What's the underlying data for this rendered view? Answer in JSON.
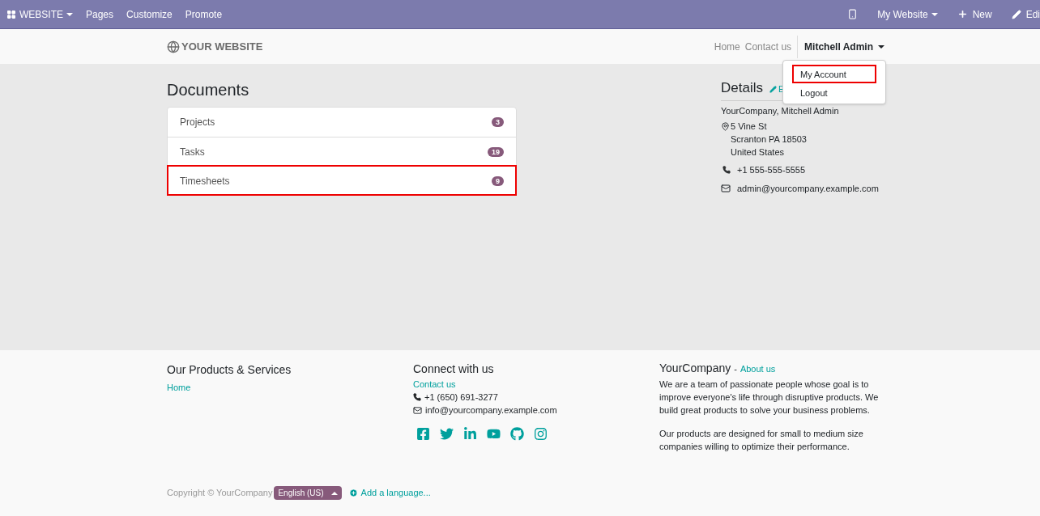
{
  "topbar": {
    "app_menu": "WEBSITE",
    "menu": [
      "Pages",
      "Customize",
      "Promote"
    ],
    "website_switcher": "My Website",
    "new_button": "New",
    "edit_button": "Edi"
  },
  "header": {
    "logo": "YOUR WEBSITE",
    "nav": [
      "Home",
      "Contact us"
    ],
    "user": "Mitchell Admin"
  },
  "user_menu": {
    "items": [
      {
        "label": "My Account",
        "highlighted": true
      },
      {
        "label": "Logout",
        "highlighted": false
      }
    ]
  },
  "documents": {
    "title": "Documents",
    "items": [
      {
        "label": "Projects",
        "count": "3",
        "highlighted": false
      },
      {
        "label": "Tasks",
        "count": "19",
        "highlighted": false
      },
      {
        "label": "Timesheets",
        "count": "9",
        "highlighted": true
      }
    ]
  },
  "details": {
    "title": "Details",
    "edit_link": "E",
    "name": "YourCompany, Mitchell Admin",
    "address": [
      "5 Vine St",
      "Scranton PA 18503",
      "United States"
    ],
    "phone": "+1 555-555-5555",
    "email": "admin@yourcompany.example.com"
  },
  "footer": {
    "products": {
      "title": "Our Products & Services",
      "links": [
        "Home"
      ]
    },
    "connect": {
      "title": "Connect with us",
      "link": "Contact us",
      "phone": "+1 (650) 691-3277",
      "email": "info@yourcompany.example.com"
    },
    "company": {
      "title": "YourCompany",
      "separator": "-",
      "link": "About us",
      "paragraphs": [
        "We are a team of passionate people whose goal is to improve everyone's life through disruptive products. We build great products to solve your business problems.",
        "Our products are designed for small to medium size companies willing to optimize their performance."
      ]
    },
    "copyright": "Copyright © YourCompany",
    "language": "English (US)",
    "add_language": "Add a language..."
  }
}
